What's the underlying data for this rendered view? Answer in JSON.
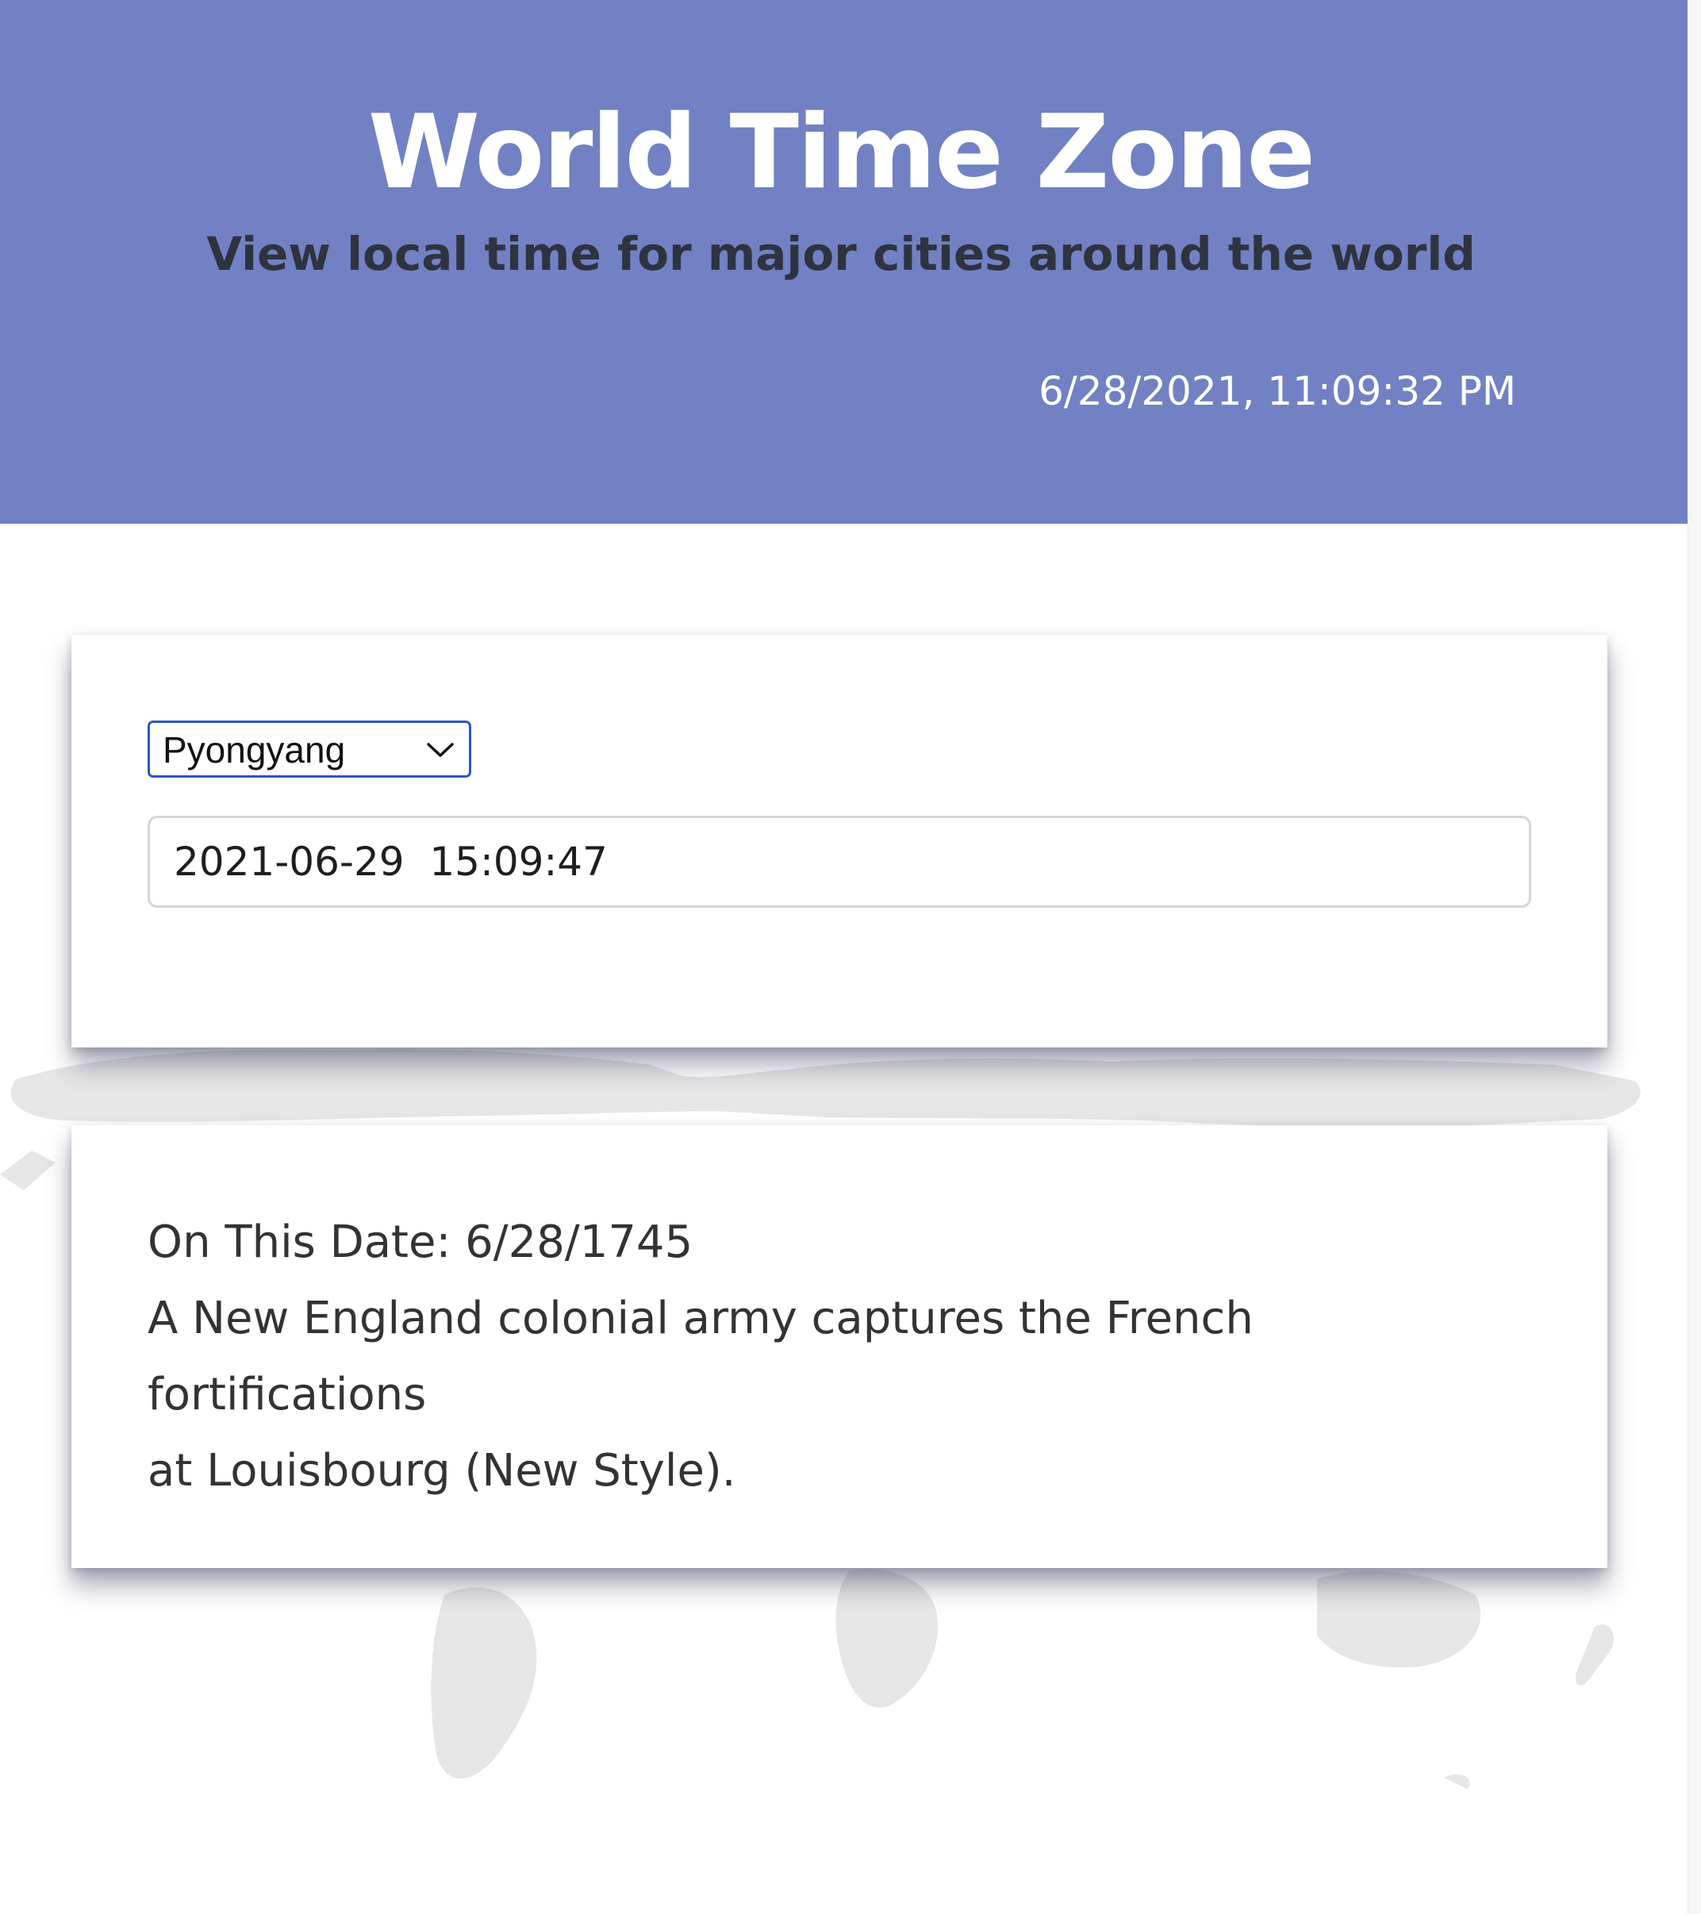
{
  "header": {
    "title": "World Time Zone",
    "subtitle": "View local time for major cities around the world",
    "local_datetime": "6/28/2021, 11:09:32 PM",
    "background_color": "#7181c4"
  },
  "city_selector": {
    "selected_city": "Pyongyang",
    "icon": "chevron-down-icon"
  },
  "city_time": {
    "value": "2021-06-29  15:09:47"
  },
  "on_this_date": {
    "heading": "On This Date: 6/28/1745",
    "event_line_1": "A New England colonial army captures the French fortifications",
    "event_line_2": "at Louisbourg (New Style)."
  }
}
